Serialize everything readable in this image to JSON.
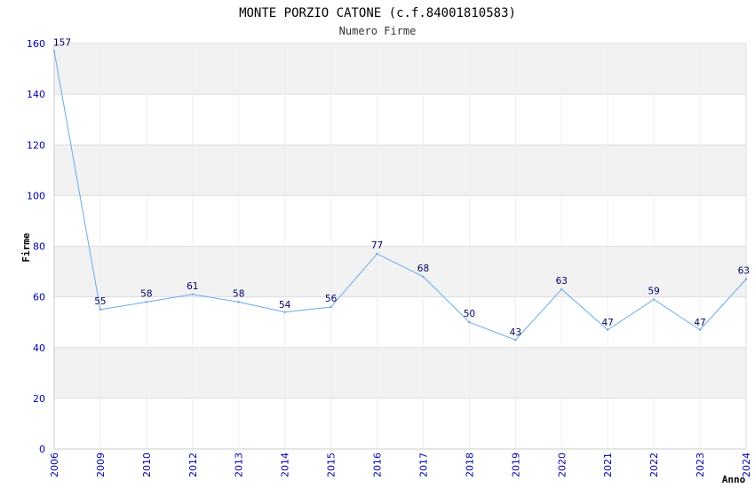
{
  "chart_data": {
    "type": "line",
    "title": "MONTE PORZIO CATONE (c.f.84001810583)",
    "subtitle": "Numero Firme",
    "xlabel": "Anno",
    "ylabel": "Firme",
    "categories": [
      "2006",
      "2009",
      "2010",
      "2012",
      "2013",
      "2014",
      "2015",
      "2016",
      "2017",
      "2018",
      "2019",
      "2020",
      "2021",
      "2022",
      "2023",
      "2024"
    ],
    "values": [
      157,
      55,
      58,
      61,
      58,
      54,
      56,
      77,
      68,
      50,
      43,
      63,
      47,
      59,
      47,
      67
    ],
    "data_labels": [
      "157",
      "55",
      "58",
      "61",
      "58",
      "54",
      "56",
      "77",
      "68",
      "50",
      "43",
      "63",
      "47",
      "59",
      "47",
      "63"
    ],
    "ylim": [
      0,
      160
    ],
    "yticks": [
      0,
      20,
      40,
      60,
      80,
      100,
      120,
      140,
      160
    ],
    "grid": true,
    "colors": {
      "line": "#66aaee",
      "band": "#f2f2f2",
      "grid": "#dddddd",
      "tick_text": "#0000aa",
      "data_label_text": "#000066"
    }
  }
}
